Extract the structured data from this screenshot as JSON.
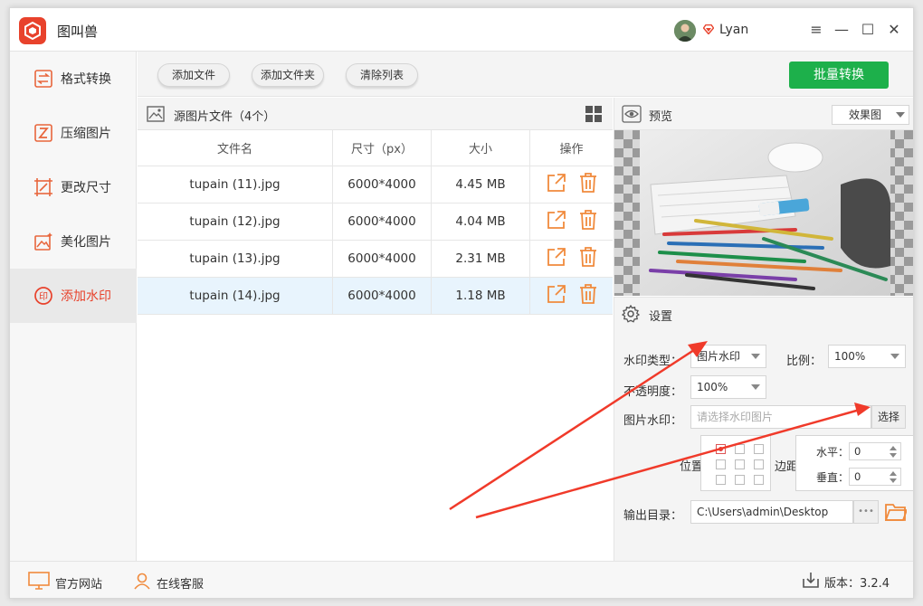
{
  "app": {
    "title": "图叫兽",
    "user": "Lyan",
    "brand_color": "#e8422c",
    "accent_green": "#1db04b"
  },
  "window_controls": {
    "menu": "≡",
    "minimize": "—",
    "maximize": "☐",
    "close": "✕"
  },
  "sidebar": {
    "items": [
      {
        "label": "格式转换",
        "icon": "convert-icon"
      },
      {
        "label": "压缩图片",
        "icon": "compress-icon"
      },
      {
        "label": "更改尺寸",
        "icon": "resize-icon"
      },
      {
        "label": "美化图片",
        "icon": "beautify-icon"
      },
      {
        "label": "添加水印",
        "icon": "watermark-icon",
        "active": true
      }
    ]
  },
  "toolbar": {
    "add_file": "添加文件",
    "add_folder": "添加文件夹",
    "clear_list": "清除列表",
    "batch_convert": "批量转换"
  },
  "files": {
    "header": "源图片文件（4个）",
    "columns": [
      "文件名",
      "尺寸（px）",
      "大小",
      "操作"
    ],
    "rows": [
      {
        "name": "tupain (11).jpg",
        "dims": "6000*4000",
        "size": "4.45 MB"
      },
      {
        "name": "tupain (12).jpg",
        "dims": "6000*4000",
        "size": "4.04 MB"
      },
      {
        "name": "tupain (13).jpg",
        "dims": "6000*4000",
        "size": "2.31 MB"
      },
      {
        "name": "tupain (14).jpg",
        "dims": "6000*4000",
        "size": "1.18 MB",
        "selected": true
      }
    ]
  },
  "preview": {
    "title": "预览",
    "mode": "效果图"
  },
  "settings": {
    "title": "设置",
    "watermark_type_label": "水印类型：",
    "watermark_type_value": "图片水印",
    "ratio_label": "比例：",
    "ratio_value": "100%",
    "opacity_label": "不透明度：",
    "opacity_value": "100%",
    "image_wm_label": "图片水印：",
    "image_wm_placeholder": "请选择水印图片",
    "choose_button": "选择",
    "position_label": "位置",
    "margin_label": "边距",
    "horizontal_label": "水平：",
    "horizontal_value": "0",
    "vertical_label": "垂直：",
    "vertical_value": "0",
    "output_label": "输出目录：",
    "output_path": "C:\\Users\\admin\\Desktop",
    "more": "•••"
  },
  "footer": {
    "website": "官方网站",
    "support": "在线客服",
    "version": "版本：3.2.4"
  }
}
